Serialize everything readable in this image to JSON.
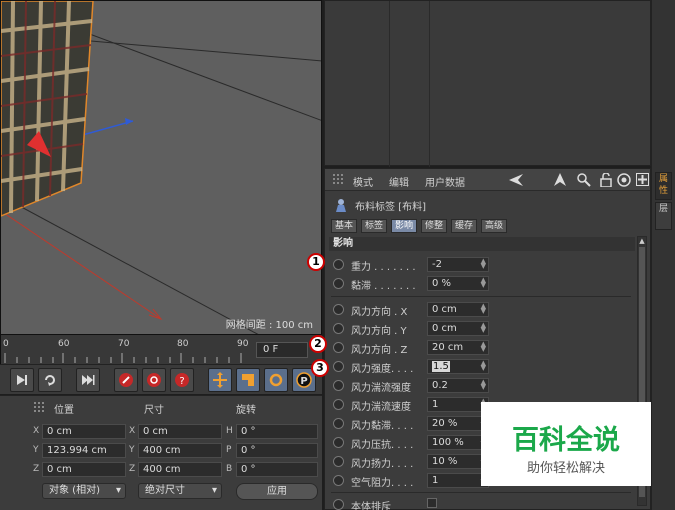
{
  "viewport": {
    "grid_spacing": "网格间距 : 100 cm"
  },
  "timeline": {
    "ticks": [
      "0",
      "60",
      "70",
      "80",
      "90"
    ],
    "frame": "0 F"
  },
  "coords": {
    "headers": {
      "position": "位置",
      "size": "尺寸",
      "rotation": "旋转"
    },
    "position": [
      {
        "axis": "X",
        "value": "0 cm"
      },
      {
        "axis": "Y",
        "value": "123.994 cm"
      },
      {
        "axis": "Z",
        "value": "0 cm"
      }
    ],
    "size": [
      {
        "axis": "X",
        "value": "0 cm"
      },
      {
        "axis": "Y",
        "value": "400 cm"
      },
      {
        "axis": "Z",
        "value": "400 cm"
      }
    ],
    "rotation": [
      {
        "axis": "H",
        "value": "0 °"
      },
      {
        "axis": "P",
        "value": "0 °"
      },
      {
        "axis": "B",
        "value": "0 °"
      }
    ],
    "mode_dropdown": "对象 (相对)",
    "size_dropdown": "绝对尺寸",
    "apply": "应用"
  },
  "attr": {
    "menu": {
      "mode": "模式",
      "edit": "编辑",
      "userdata": "用户数据"
    },
    "object_title": "布料标签 [布料]",
    "tabs": [
      "基本",
      "标签",
      "影响",
      "修整",
      "缓存",
      "高级"
    ],
    "active_tab": "影响",
    "section": "影响",
    "params": [
      {
        "label": "重力 . . . . . . .",
        "value": "-2"
      },
      {
        "label": "黏滞 . . . . . . .",
        "value": "0 %"
      },
      {
        "label": "风力方向 . X",
        "value": "0 cm"
      },
      {
        "label": "风力方向 . Y",
        "value": "0 cm"
      },
      {
        "label": "风力方向 . Z",
        "value": "20 cm"
      },
      {
        "label": "风力强度. . . .",
        "value": "1.5"
      },
      {
        "label": "风力湍流强度",
        "value": "0.2"
      },
      {
        "label": "风力湍流速度",
        "value": "1"
      },
      {
        "label": "风力黏滞. . . .",
        "value": "20 %"
      },
      {
        "label": "风力压抗. . . .",
        "value": "100 %"
      },
      {
        "label": "风力扬力. . . .",
        "value": "10 %"
      },
      {
        "label": "空气阻力. . . .",
        "value": "1"
      },
      {
        "label": "本体排斥",
        "value": ""
      }
    ]
  },
  "sidebar": {
    "tab1": "属性",
    "tab2": "层"
  },
  "callouts": [
    "1",
    "2",
    "3"
  ],
  "watermark": {
    "title": "百科全说",
    "subtitle": "助你轻松解决"
  }
}
